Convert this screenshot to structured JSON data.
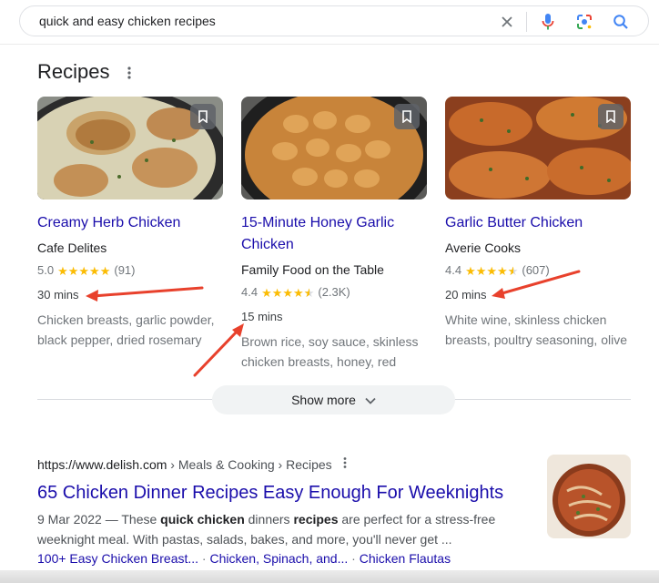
{
  "search": {
    "query": "quick and easy chicken recipes"
  },
  "recipes": {
    "heading": "Recipes",
    "cards": [
      {
        "title": "Creamy Herb Chicken",
        "source": "Cafe Delites",
        "rating": "5.0",
        "stars": 5,
        "reviews": "(91)",
        "time": "30 mins",
        "ingredients": "Chicken breasts, garlic powder, black pepper, dried rosemary"
      },
      {
        "title": "15-Minute Honey Garlic Chicken",
        "source": "Family Food on the Table",
        "rating": "4.4",
        "stars": 4.5,
        "reviews": "(2.3K)",
        "time": "15 mins",
        "ingredients": "Brown rice, soy sauce, skinless chicken breasts, honey, red"
      },
      {
        "title": "Garlic Butter Chicken",
        "source": "Averie Cooks",
        "rating": "4.4",
        "stars": 4.5,
        "reviews": "(607)",
        "time": "20 mins",
        "ingredients": "White wine, skinless chicken breasts, poultry seasoning, olive"
      }
    ],
    "show_more": "Show more"
  },
  "result": {
    "url": "https://www.delish.com",
    "path": "› Meals & Cooking › Recipes",
    "title": "65 Chicken Dinner Recipes Easy Enough For Weeknights",
    "date": "9 Mar 2022",
    "snippet_1": " — These ",
    "snippet_bold_1": "quick chicken",
    "snippet_2": " dinners ",
    "snippet_bold_2": "recipes",
    "snippet_3": " are perfect for a stress-free weeknight meal. With pastas, salads, bakes, and more, you'll never get ...",
    "sitelinks": [
      "100+ Easy Chicken Breast...",
      "Chicken, Spinach, and...",
      "Chicken Flautas"
    ],
    "sitelink_sep": " · "
  },
  "colors": {
    "link": "#1a0dab",
    "star": "#fbbc04",
    "annotation_arrow": "#e8412c"
  },
  "icons": [
    "clear-icon",
    "mic-icon",
    "lens-icon",
    "search-icon",
    "more-vert-icon",
    "bookmark-icon",
    "chevron-down-icon"
  ]
}
